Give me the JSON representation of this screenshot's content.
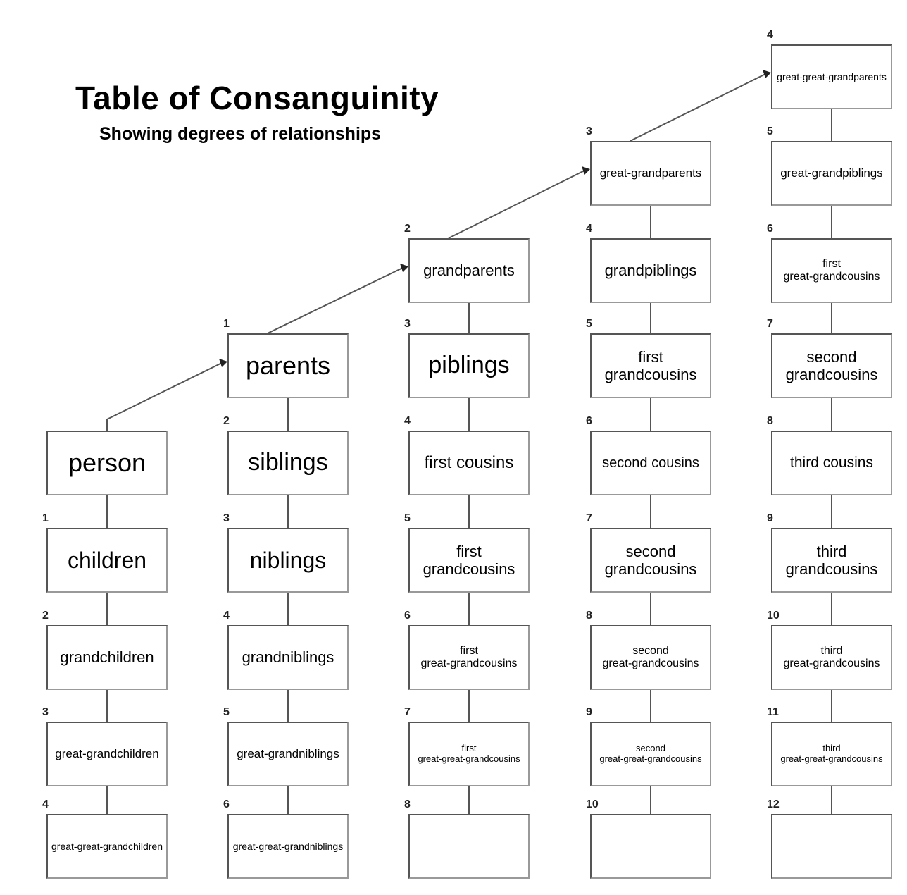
{
  "title": "Table of Consanguinity",
  "subtitle": "Showing degrees of relationships",
  "columns": [
    {
      "cells": [
        {
          "degree": "",
          "label": "person",
          "size": 36
        },
        {
          "degree": "1",
          "label": "children",
          "size": 32
        },
        {
          "degree": "2",
          "label": "grandchildren",
          "size": 22
        },
        {
          "degree": "3",
          "label": "great-grandchildren",
          "size": 17
        },
        {
          "degree": "4",
          "label": "great-great-grandchildren",
          "size": 14
        }
      ]
    },
    {
      "cells": [
        {
          "degree": "1",
          "label": "parents",
          "size": 36
        },
        {
          "degree": "2",
          "label": "siblings",
          "size": 34
        },
        {
          "degree": "3",
          "label": "niblings",
          "size": 32
        },
        {
          "degree": "4",
          "label": "grandniblings",
          "size": 22
        },
        {
          "degree": "5",
          "label": "great-grandniblings",
          "size": 17
        },
        {
          "degree": "6",
          "label": "great-great-grandniblings",
          "size": 14
        }
      ]
    },
    {
      "cells": [
        {
          "degree": "2",
          "label": "grandparents",
          "size": 22
        },
        {
          "degree": "3",
          "label": "piblings",
          "size": 34
        },
        {
          "degree": "4",
          "label": "first cousins",
          "size": 24
        },
        {
          "degree": "5",
          "label": "first\ngrandcousins",
          "size": 22
        },
        {
          "degree": "6",
          "label": "first\ngreat-grandcousins",
          "size": 16
        },
        {
          "degree": "7",
          "label": "first\ngreat-great-grandcousins",
          "size": 13
        },
        {
          "degree": "8",
          "label": "",
          "size": 14
        }
      ]
    },
    {
      "cells": [
        {
          "degree": "3",
          "label": "great-grandparents",
          "size": 17
        },
        {
          "degree": "4",
          "label": "grandpiblings",
          "size": 22
        },
        {
          "degree": "5",
          "label": "first\ngrandcousins",
          "size": 22
        },
        {
          "degree": "6",
          "label": "second cousins",
          "size": 20
        },
        {
          "degree": "7",
          "label": "second\ngrandcousins",
          "size": 22
        },
        {
          "degree": "8",
          "label": "second\ngreat-grandcousins",
          "size": 16
        },
        {
          "degree": "9",
          "label": "second\ngreat-great-grandcousins",
          "size": 13
        },
        {
          "degree": "10",
          "label": "",
          "size": 14
        }
      ]
    },
    {
      "cells": [
        {
          "degree": "4",
          "label": "great-great-grandparents",
          "size": 14
        },
        {
          "degree": "5",
          "label": "great-grandpiblings",
          "size": 17
        },
        {
          "degree": "6",
          "label": "first\ngreat-grandcousins",
          "size": 16
        },
        {
          "degree": "7",
          "label": "second\ngrandcousins",
          "size": 22
        },
        {
          "degree": "8",
          "label": "third cousins",
          "size": 21
        },
        {
          "degree": "9",
          "label": "third\ngrandcousins",
          "size": 22
        },
        {
          "degree": "10",
          "label": "third\ngreat-grandcousins",
          "size": 16
        },
        {
          "degree": "11",
          "label": "third\ngreat-great-grandcousins",
          "size": 13
        },
        {
          "degree": "12",
          "label": "",
          "size": 14
        }
      ]
    }
  ]
}
